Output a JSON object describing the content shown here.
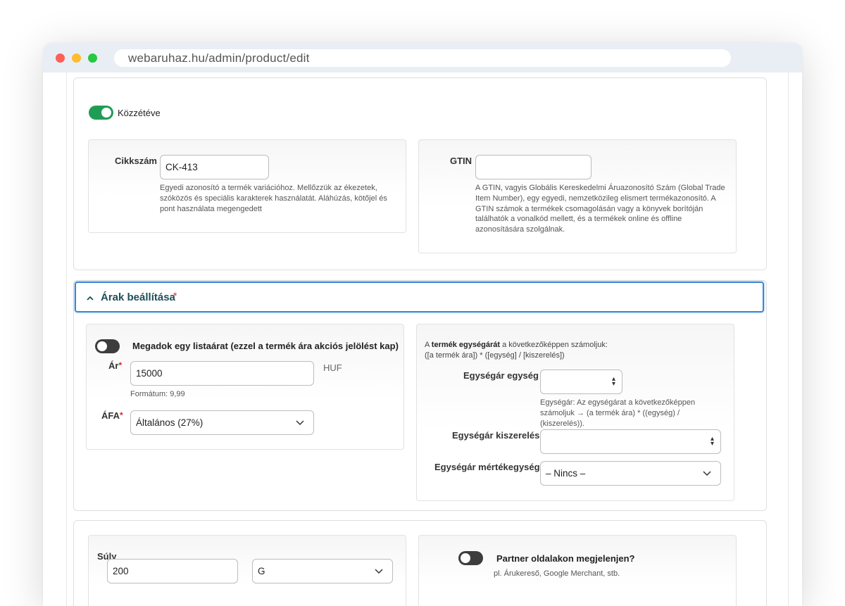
{
  "browser": {
    "url": "webaruhaz.hu/admin/product/edit"
  },
  "publish": {
    "label": "Közzétéve",
    "enabled": true
  },
  "sku": {
    "label": "Cikkszám",
    "value": "CK-413",
    "help": "Egyedi azonosító a termék variációhoz. Mellőzzük az ékezetek, szóközös és speciális karakterek használatát. Aláhúzás, kötőjel és pont használata megengedett"
  },
  "gtin": {
    "label": "GTIN",
    "value": "",
    "help": "A GTIN, vagyis Globális Kereskedelmi Áruazonosító Szám (Global Trade Item Number), egy egyedi, nemzetközileg elismert termékazonosító. A GTIN számok a termékek csomagolásán vagy a könyvek borítóján találhatók a vonalkód mellett, és a termékek online és offline azonosítására szolgálnak."
  },
  "prices_section": {
    "title": "Árak beállítása",
    "required_mark": "*",
    "list_price_toggle": {
      "label": "Megadok egy listaárat (ezzel a termék ára akciós jelölést kap)",
      "enabled": false
    },
    "price": {
      "label": "Ár",
      "value": "15000",
      "currency": "HUF",
      "format_help": "Formátum: 9,99"
    },
    "vat": {
      "label": "ÁFA",
      "selected": "Általános (27%)"
    },
    "unit_price": {
      "intro_prefix": "A ",
      "intro_bold": "termék egységárát",
      "intro_suffix": " a következőképpen számoljuk:",
      "formula": "([a termék ára]) * ([egység] / [kiszerelés])",
      "unit_label": "Egységár egység",
      "unit_value": "",
      "unit_help": "Egységár: Az egységárat a következőképpen számoljuk → (a termék ára) * ((egység) / (kiszerelés)).",
      "packaging_label": "Egységár kiszerelés",
      "packaging_value": "",
      "measure_label": "Egységár mértékegység",
      "measure_selected": "– Nincs –"
    }
  },
  "weight": {
    "label": "Súly",
    "value": "200",
    "unit_selected": "G"
  },
  "partner": {
    "label": "Partner oldalakon megjelenjen?",
    "help": "pl. Árukereső, Google Merchant, stb.",
    "enabled": false
  },
  "colors": {
    "toggle_on": "#1f9d55",
    "toggle_off": "#3d3d3d",
    "accent_blue": "#3a86d6",
    "section_title": "#1d4f57",
    "required": "#e02424"
  }
}
